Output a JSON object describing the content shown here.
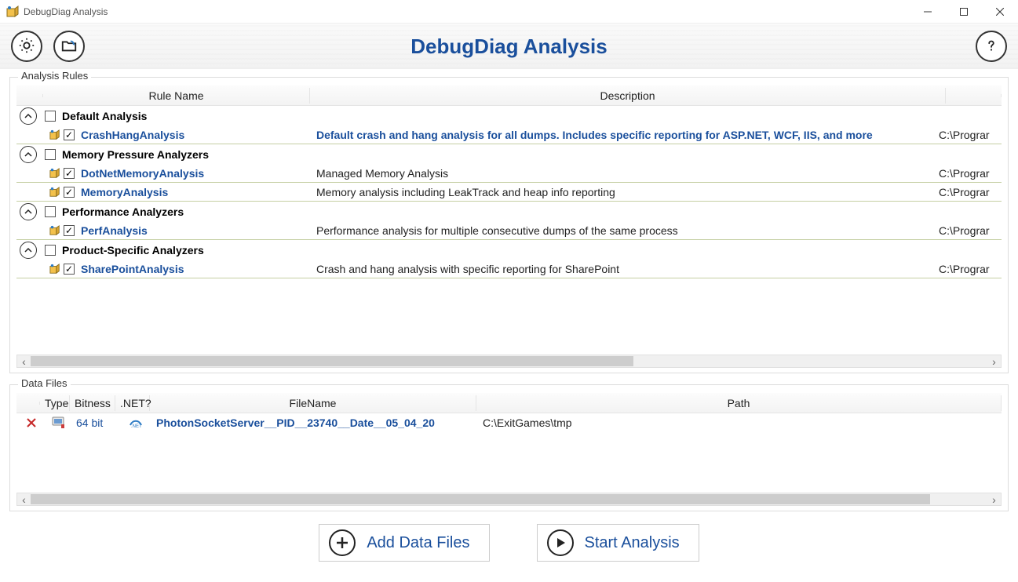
{
  "window": {
    "title": "DebugDiag Analysis"
  },
  "header": {
    "title": "DebugDiag Analysis"
  },
  "sections": {
    "rules_label": "Analysis Rules",
    "data_label": "Data Files"
  },
  "rules_columns": {
    "name": "Rule Name",
    "description": "Description"
  },
  "rule_groups": [
    {
      "name": "Default Analysis",
      "checked": false,
      "items": [
        {
          "name": "CrashHangAnalysis",
          "checked": true,
          "description": "Default crash and hang analysis for all dumps.  Includes specific reporting for ASP.NET, WCF, IIS, and more",
          "desc_bold": true,
          "path": "C:\\Prograr"
        }
      ]
    },
    {
      "name": "Memory Pressure Analyzers",
      "checked": false,
      "items": [
        {
          "name": "DotNetMemoryAnalysis",
          "checked": true,
          "description": "Managed Memory Analysis",
          "desc_bold": false,
          "path": "C:\\Prograr"
        },
        {
          "name": "MemoryAnalysis",
          "checked": true,
          "description": "Memory analysis including LeakTrack and heap info reporting",
          "desc_bold": false,
          "path": "C:\\Prograr"
        }
      ]
    },
    {
      "name": "Performance Analyzers",
      "checked": false,
      "items": [
        {
          "name": "PerfAnalysis",
          "checked": true,
          "description": "Performance analysis for multiple consecutive dumps of the same process",
          "desc_bold": false,
          "path": "C:\\Prograr"
        }
      ]
    },
    {
      "name": "Product-Specific Analyzers",
      "checked": false,
      "items": [
        {
          "name": "SharePointAnalysis",
          "checked": true,
          "description": "Crash and hang analysis with specific reporting for SharePoint",
          "desc_bold": false,
          "path": "C:\\Prograr"
        }
      ]
    }
  ],
  "data_columns": {
    "type": "Type",
    "bitness": "Bitness",
    "net": ".NET?",
    "filename": "FileName",
    "path": "Path"
  },
  "data_rows": [
    {
      "bitness": "64 bit",
      "filename": "PhotonSocketServer__PID__23740__Date__05_04_20",
      "path": "C:\\ExitGames\\tmp"
    }
  ],
  "actions": {
    "add_files": "Add Data Files",
    "start_analysis": "Start Analysis"
  }
}
